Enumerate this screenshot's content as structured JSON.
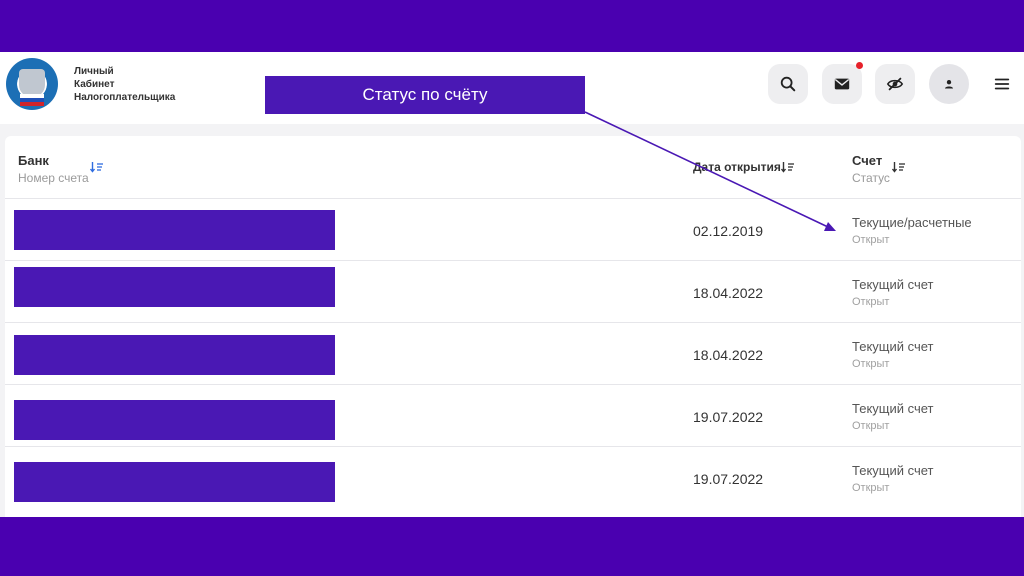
{
  "header": {
    "brand_lines": [
      "Личный",
      "Кабинет",
      "Налогоплательщика"
    ],
    "buttons": [
      {
        "name": "search",
        "icon": "search-icon"
      },
      {
        "name": "messages",
        "icon": "envelope-icon",
        "notification": true
      },
      {
        "name": "visibility",
        "icon": "eye-slash-icon"
      },
      {
        "name": "profile",
        "icon": "user-icon"
      },
      {
        "name": "menu",
        "icon": "hamburger-icon"
      }
    ]
  },
  "table": {
    "col_bank": "Банк",
    "col_bank_sub": "Номер счета",
    "col_date": "Дата открытия",
    "col_account": "Счет",
    "col_account_sub": "Статус",
    "rows": [
      {
        "date": "02.12.2019",
        "account": "Текущие/расчетные",
        "status": "Открыт"
      },
      {
        "date": "18.04.2022",
        "account": "Текущий счет",
        "status": "Открыт"
      },
      {
        "date": "18.04.2022",
        "account": "Текущий счет",
        "status": "Открыт"
      },
      {
        "date": "19.07.2022",
        "account": "Текущий счет",
        "status": "Открыт"
      },
      {
        "date": "19.07.2022",
        "account": "Текущий счет",
        "status": "Открыт"
      }
    ]
  },
  "annotation": {
    "callout": "Статус по счёту"
  },
  "colors": {
    "frame": "#4a00b0",
    "redaction": "#4a18b4",
    "notification_dot": "#e6212a"
  }
}
